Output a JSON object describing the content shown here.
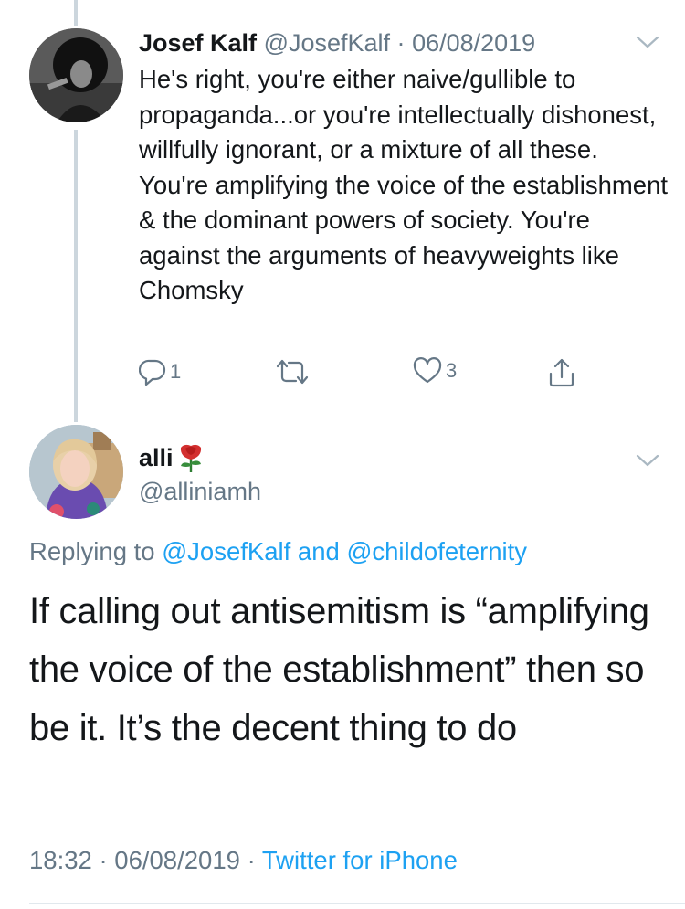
{
  "tweet1": {
    "name": "Josef Kalf",
    "handle": "@JosefKalf",
    "separator": "·",
    "date": "06/08/2019",
    "text": "He's right, you're either naive/gullible to propaganda...or you're intellectually dishonest, willfully ignorant, or a mixture of all these. You're amplifying the voice of the establishment & the dominant powers of society. You're against the arguments of heavyweights like Chomsky",
    "reply_count": "1",
    "like_count": "3"
  },
  "tweet2": {
    "name": "alli",
    "handle": "@alliniamh",
    "replying_prefix": "Replying to",
    "reply_to_1": "@JosefKalf",
    "reply_and": "and",
    "reply_to_2": "@childofeternity",
    "text": "If calling out antisemitism is “amplifying the voice of the establishment” then so be it. It’s the decent thing to do",
    "time": "18:32",
    "separator": "·",
    "date": "06/08/2019",
    "separator2": "·",
    "source": "Twitter for iPhone"
  },
  "icons": {
    "reply": "reply-bubble-icon",
    "retweet": "retweet-icon",
    "like": "heart-icon",
    "share": "share-icon",
    "more": "chevron-down-icon",
    "emoji": "rose-icon"
  },
  "colors": {
    "text": "#14171a",
    "secondary": "#657786",
    "link": "#1da1f2",
    "thread_line": "#ccd6dd"
  }
}
